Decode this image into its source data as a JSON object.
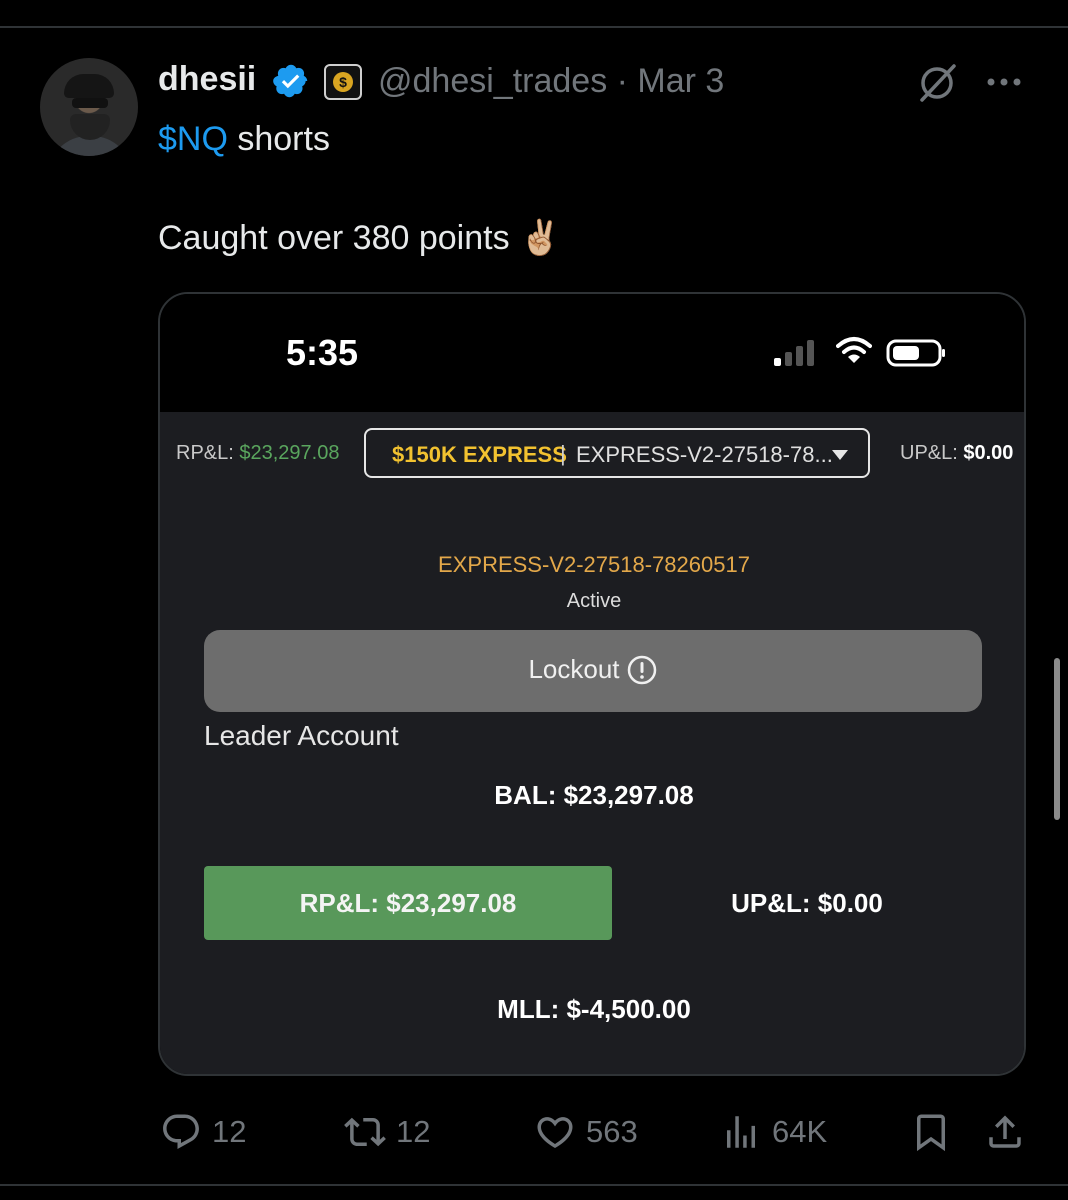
{
  "author": {
    "name": "dhesii",
    "handle": "@dhesi_trades",
    "date": "Mar 3",
    "handle_line": "@dhesi_trades · Mar 3"
  },
  "post": {
    "cashtag": "$NQ",
    "line1_rest": " shorts",
    "line2": "Caught over 380 points ✌🏼"
  },
  "phone": {
    "time": "5:35"
  },
  "app": {
    "rpl_label": "RP&L: ",
    "rpl_value": "$23,297.08",
    "plan": "$150K EXPRESS",
    "separator": "|",
    "account_truncated": "EXPRESS-V2-27518-78...",
    "upl_label": "UP&L: ",
    "upl_value": "$0.00",
    "account_id": "EXPRESS-V2-27518-78260517",
    "account_status": "Active",
    "lockout_label": "Lockout",
    "leader_label": "Leader Account",
    "balance": "BAL: $23,297.08",
    "rpl_button": "RP&L: $23,297.08",
    "upl_mid": "UP&L: $0.00",
    "mll": "MLL: $-4,500.00"
  },
  "actions": {
    "replies": "12",
    "reposts": "12",
    "likes": "563",
    "views": "64K"
  },
  "colors": {
    "accent": "#1d9bf0",
    "muted": "#71767b",
    "green": "#58985a",
    "gold": "#f2c230",
    "orange": "#e3a84a"
  }
}
